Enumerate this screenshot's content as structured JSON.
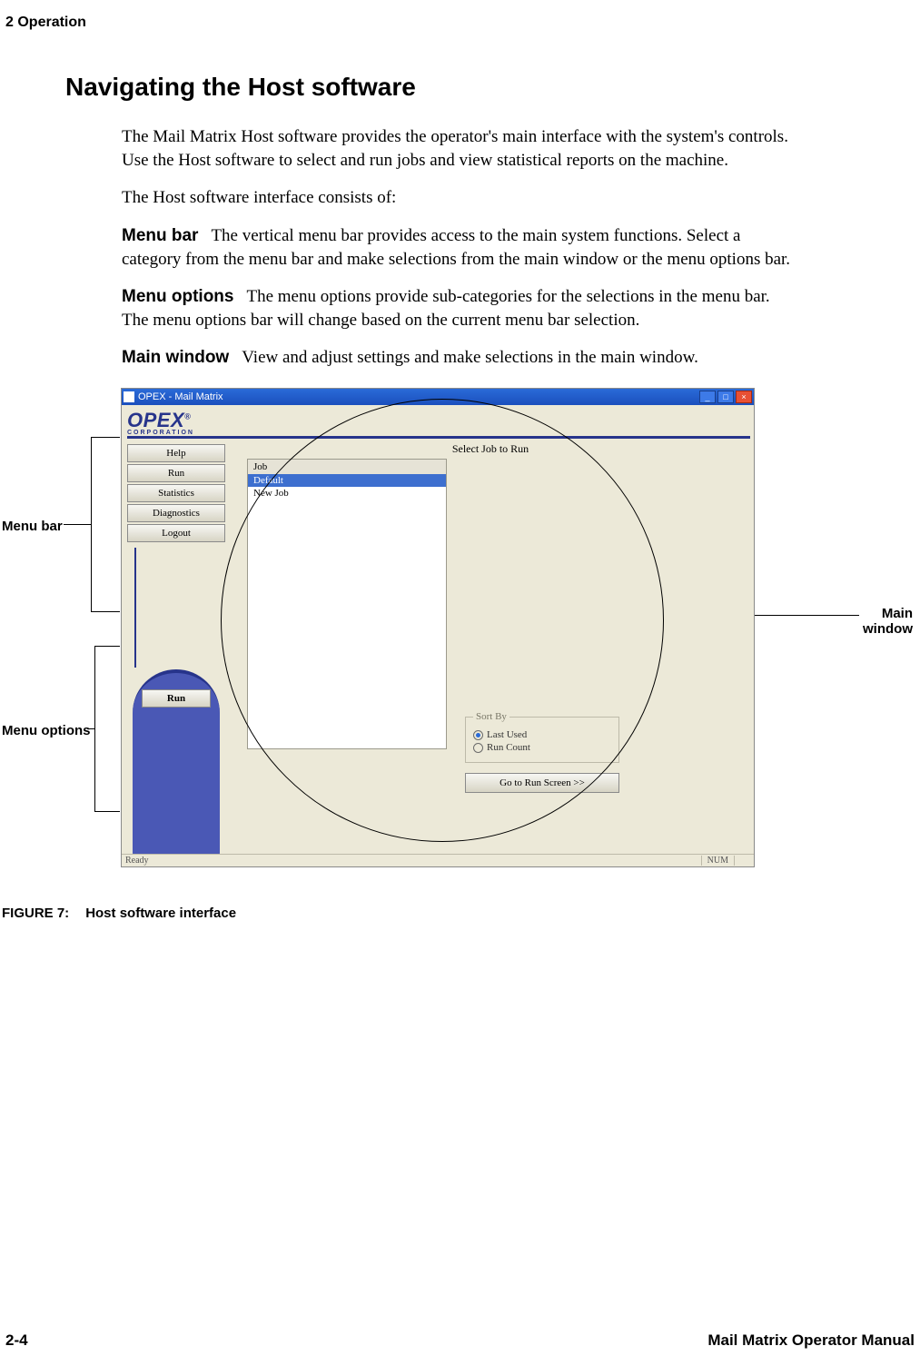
{
  "header": {
    "section": "2  Operation"
  },
  "title": "Navigating the Host software",
  "para_intro": "The Mail Matrix Host software provides the operator's main interface with the system's controls. Use the Host software to select and run jobs and view statistical reports on the machine.",
  "para_consists": "The Host software interface consists of:",
  "defs": {
    "menu_bar": {
      "term": "Menu bar",
      "text": "The vertical menu bar provides access to the main system functions. Select a category from the menu bar and make selections from the main window or the menu options bar."
    },
    "menu_options": {
      "term": "Menu options",
      "text": "The menu options provide sub-categories for the selections in the menu bar. The menu options bar will change based on the current menu bar selection."
    },
    "main_window": {
      "term": "Main window",
      "text": "View and adjust settings and make selections in the main window."
    }
  },
  "callouts": {
    "menu_bar": "Menu bar",
    "menu_options": "Menu options",
    "main_window_l1": "Main",
    "main_window_l2": "window"
  },
  "screenshot": {
    "title": "OPEX - Mail Matrix",
    "logo": {
      "brand": "OPEX",
      "reg": "®",
      "sub": "CORPORATION"
    },
    "menu_items": [
      "Help",
      "Run",
      "Statistics",
      "Diagnostics",
      "Logout"
    ],
    "option_button": "Run",
    "main_heading": "Select Job to Run",
    "job_header": "Job",
    "jobs": [
      "Default",
      "New Job"
    ],
    "selected_job_index": 0,
    "sort_legend": "Sort By",
    "sort_options": [
      "Last Used",
      "Run Count"
    ],
    "sort_selected_index": 0,
    "go_button": "Go to Run Screen >>",
    "status_ready": "Ready",
    "status_num": "NUM",
    "win_min": "_",
    "win_max": "□",
    "win_close": "×"
  },
  "figure": {
    "label": "FIGURE 7:",
    "caption": "Host software interface"
  },
  "footer": {
    "left": "2-4",
    "right": "Mail Matrix Operator Manual"
  }
}
